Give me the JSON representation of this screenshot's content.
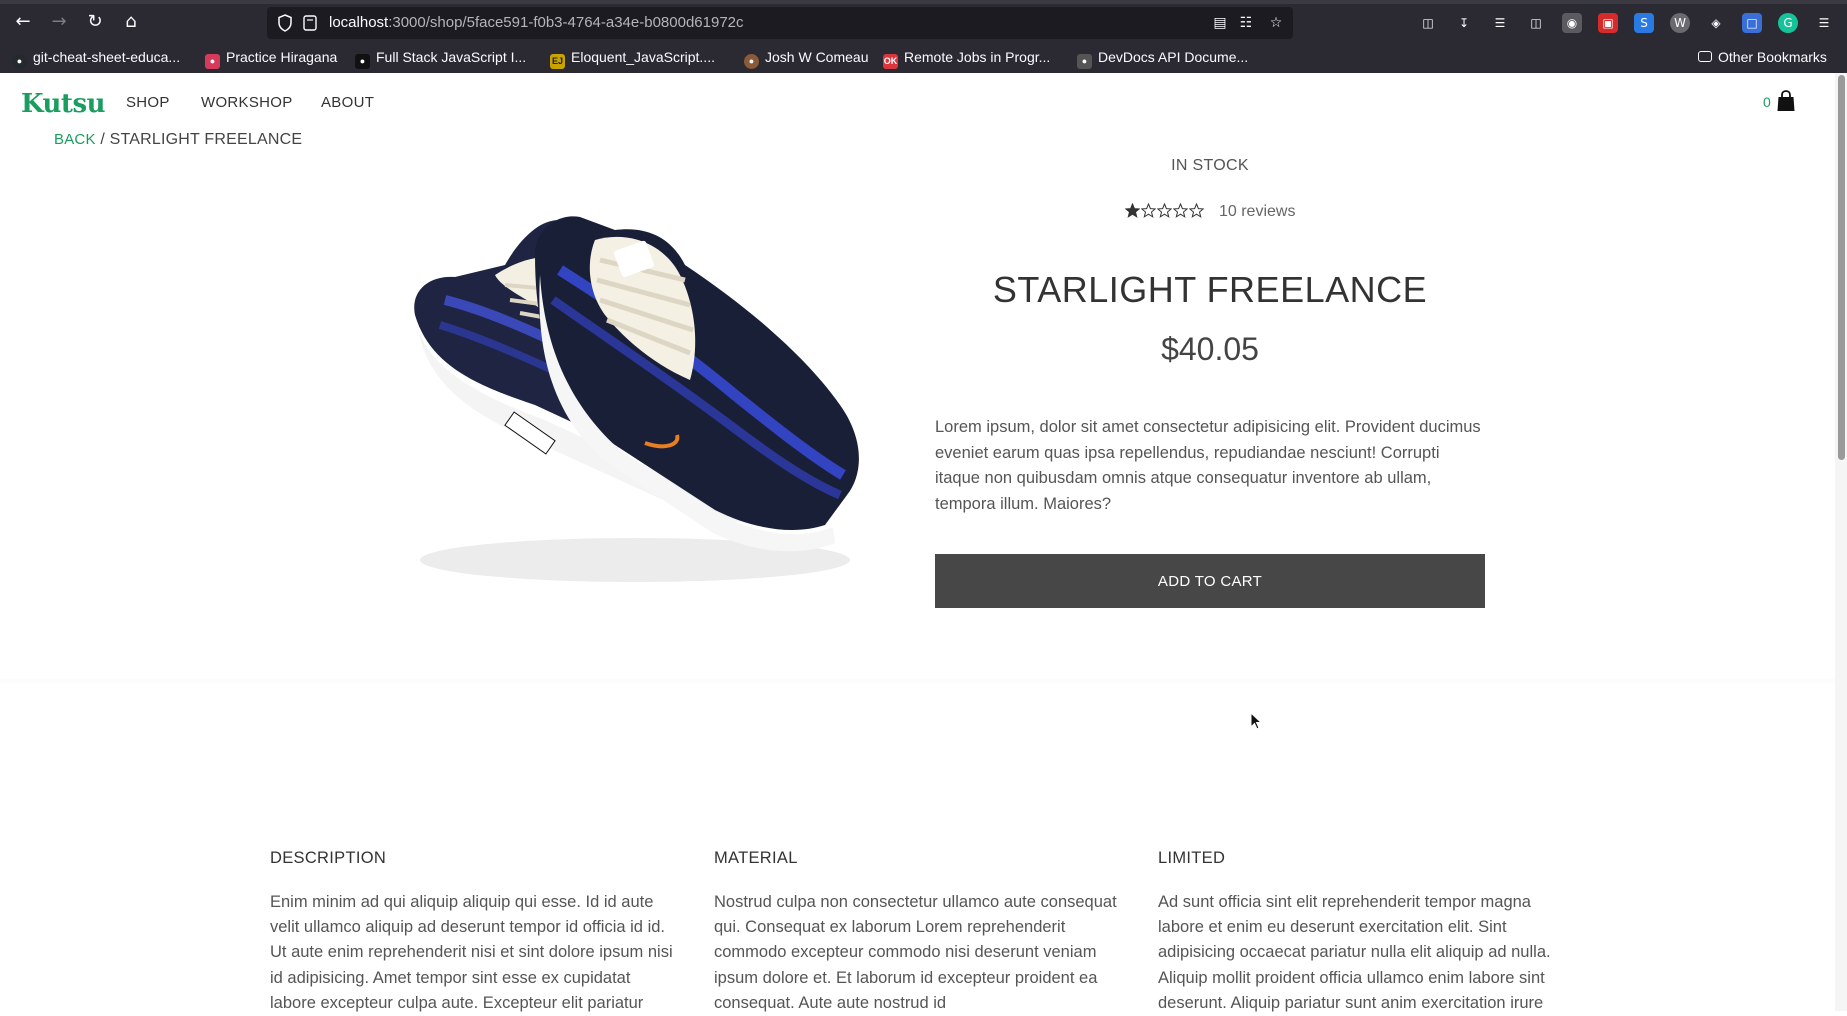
{
  "browser": {
    "url_host": "localhost",
    "url_rest": ":3000/shop/5face591-f0b3-4764-a34e-b0800d61972c",
    "bookmarks": [
      {
        "label": "git-cheat-sheet-educa...",
        "icon": "github-icon",
        "color": "#24292e"
      },
      {
        "label": "Practice Hiragana",
        "icon": "hiragana-icon",
        "color": "#d63a5a"
      },
      {
        "label": "Full Stack JavaScript I...",
        "icon": "fullstack-icon",
        "color": "#111111"
      },
      {
        "label": "Eloquent_JavaScript....",
        "icon": "ejs-icon",
        "color": "#c9a400"
      },
      {
        "label": "Josh W Comeau",
        "icon": "josh-icon",
        "color": "#8a5a3a"
      },
      {
        "label": "Remote Jobs in Progr...",
        "icon": "ok-icon",
        "color": "#d9363e"
      },
      {
        "label": "DevDocs API Docume...",
        "icon": "devdocs-icon",
        "color": "#555555"
      }
    ],
    "other_bookmarks": "Other Bookmarks"
  },
  "site": {
    "logo": "Kutsu",
    "nav": [
      "SHOP",
      "WORKSHOP",
      "ABOUT"
    ],
    "cart_count": "0",
    "accent": "#1a9e5f"
  },
  "breadcrumb": {
    "back": "BACK",
    "sep": "/",
    "current": "STARLIGHT FREELANCE"
  },
  "product": {
    "stock": "IN STOCK",
    "rating_value": 1,
    "rating_max": 5,
    "reviews": "10 reviews",
    "title": "STARLIGHT FREELANCE",
    "price": "$40.05",
    "description": "Lorem ipsum, dolor sit amet consectetur adipisicing elit. Provident ducimus eveniet earum quas ipsa repellendus, repudiandae nesciunt! Corrupti itaque non quibusdam omnis atque consequatur inventore ab ullam, tempora illum. Maiores?",
    "add_to_cart": "ADD TO CART"
  },
  "sections": [
    {
      "heading": "DESCRIPTION",
      "body": "Enim minim ad qui aliquip aliquip qui esse. Id id aute velit ullamco aliquip ad deserunt tempor id officia id id. Ut aute enim reprehenderit nisi et sint dolore ipsum nisi id adipisicing. Amet tempor sint esse ex cupidatat labore excepteur culpa aute. Excepteur elit pariatur"
    },
    {
      "heading": "MATERIAL",
      "body": "Nostrud culpa non consectetur ullamco aute consequat qui. Consequat ex laborum Lorem reprehenderit commodo excepteur commodo nisi deserunt veniam ipsum dolore et. Et laborum id excepteur proident ea consequat. Aute aute nostrud id"
    },
    {
      "heading": "LIMITED",
      "body": "Ad sunt officia sint elit reprehenderit tempor magna labore et enim eu deserunt exercitation elit. Sint adipisicing occaecat pariatur nulla elit aliquip ad nulla. Aliquip mollit proident officia ullamco enim labore sint deserunt. Aliquip pariatur sunt anim exercitation irure"
    }
  ]
}
